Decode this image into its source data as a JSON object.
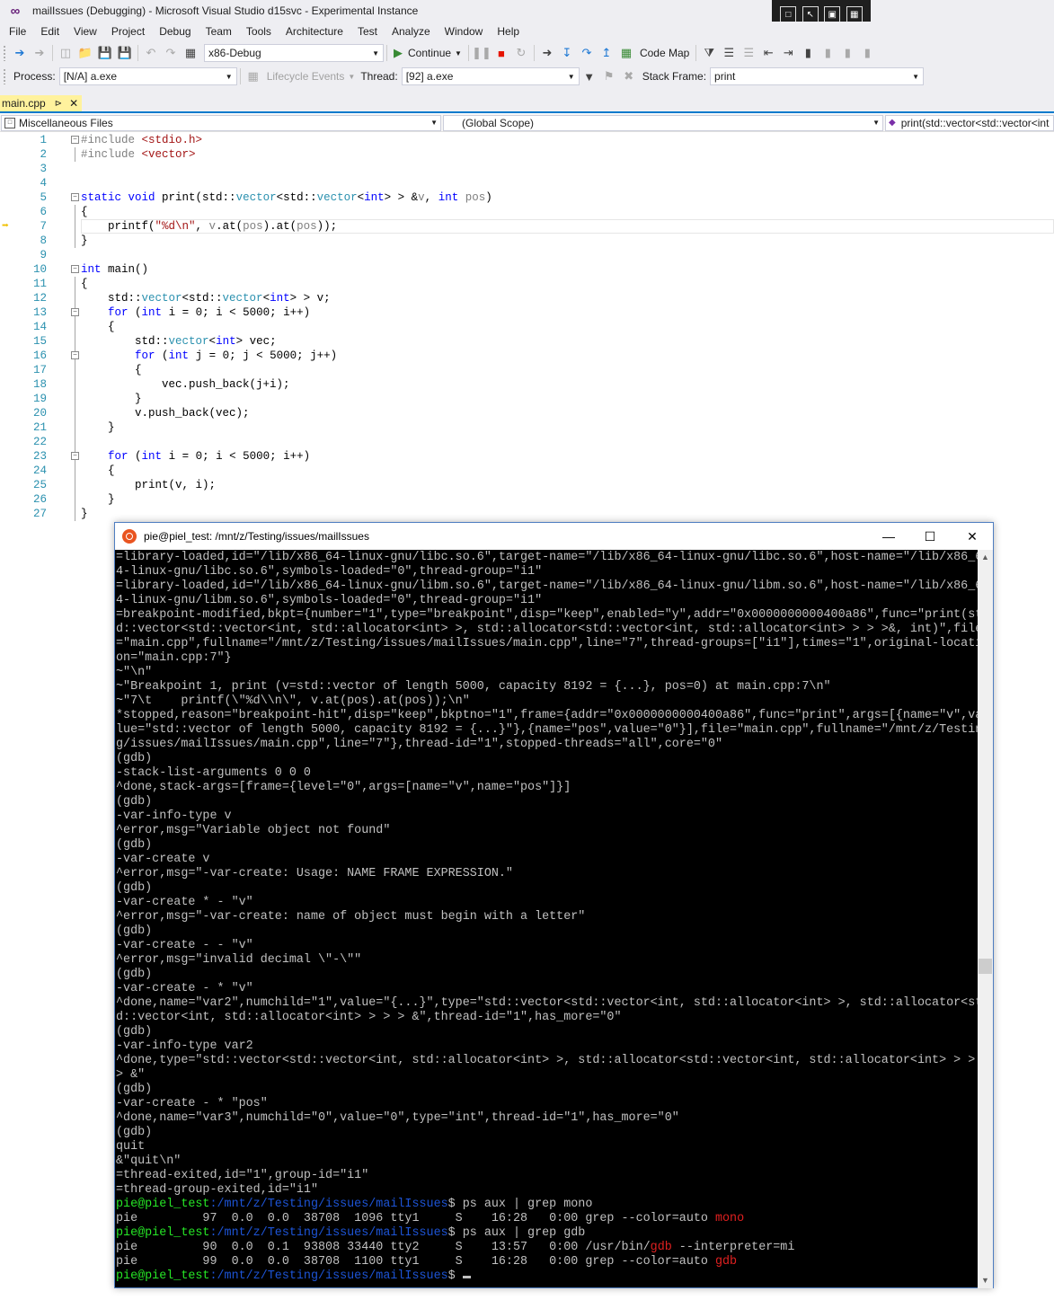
{
  "window": {
    "title": "mailIssues (Debugging) - Microsoft Visual Studio d15svc - Experimental Instance",
    "logo": "vs-logo"
  },
  "menu": [
    "File",
    "Edit",
    "View",
    "Project",
    "Debug",
    "Team",
    "Tools",
    "Architecture",
    "Test",
    "Analyze",
    "Window",
    "Help"
  ],
  "toolbar": {
    "config": "x86-Debug",
    "continue_label": "Continue",
    "code_map_label": "Code Map"
  },
  "debug_location": {
    "process_label": "Process:",
    "process_value": "[N/A] a.exe",
    "lifecycle_label": "Lifecycle Events",
    "thread_label": "Thread:",
    "thread_value": "[92] a.exe",
    "stack_frame_label": "Stack Frame:",
    "stack_frame_value": "print"
  },
  "editor_tab": {
    "filename": "main.cpp"
  },
  "navbar": {
    "project": "Miscellaneous Files",
    "scope": "(Global Scope)",
    "member": "print(std::vector<std::vector<int"
  },
  "code_lines": [
    {
      "n": "1",
      "html": "<span class=\"pp\">#include</span> <span class=\"str\">&lt;stdio.h&gt;</span>"
    },
    {
      "n": "2",
      "html": "<span class=\"pp\">#include</span> <span class=\"str\">&lt;vector&gt;</span>"
    },
    {
      "n": "3",
      "html": ""
    },
    {
      "n": "4",
      "html": ""
    },
    {
      "n": "5",
      "html": "<span class=\"kw\">static</span> <span class=\"kw\">void</span> print(std::<span class=\"typ\">vector</span>&lt;std::<span class=\"typ\">vector</span>&lt;<span class=\"kw\">int</span>&gt; &gt; &amp;<span class=\"param\">v</span>, <span class=\"kw\">int</span> <span class=\"param\">pos</span>)"
    },
    {
      "n": "6",
      "html": "{"
    },
    {
      "n": "7",
      "html": "    printf(<span class=\"str\">\"%d\\n\"</span>, <span class=\"param\">v</span>.at(<span class=\"param\">pos</span>).at(<span class=\"param\">pos</span>));"
    },
    {
      "n": "8",
      "html": "}"
    },
    {
      "n": "9",
      "html": ""
    },
    {
      "n": "10",
      "html": "<span class=\"kw\">int</span> main()"
    },
    {
      "n": "11",
      "html": "{"
    },
    {
      "n": "12",
      "html": "    std::<span class=\"typ\">vector</span>&lt;std::<span class=\"typ\">vector</span>&lt;<span class=\"kw\">int</span>&gt; &gt; v;"
    },
    {
      "n": "13",
      "html": "    <span class=\"kw\">for</span> (<span class=\"kw\">int</span> i = 0; i &lt; 5000; i++)"
    },
    {
      "n": "14",
      "html": "    {"
    },
    {
      "n": "15",
      "html": "        std::<span class=\"typ\">vector</span>&lt;<span class=\"kw\">int</span>&gt; vec;"
    },
    {
      "n": "16",
      "html": "        <span class=\"kw\">for</span> (<span class=\"kw\">int</span> j = 0; j &lt; 5000; j++)"
    },
    {
      "n": "17",
      "html": "        {"
    },
    {
      "n": "18",
      "html": "            vec.push_back(j+i);"
    },
    {
      "n": "19",
      "html": "        }"
    },
    {
      "n": "20",
      "html": "        v.push_back(vec);"
    },
    {
      "n": "21",
      "html": "    }"
    },
    {
      "n": "22",
      "html": ""
    },
    {
      "n": "23",
      "html": "    <span class=\"kw\">for</span> (<span class=\"kw\">int</span> i = 0; i &lt; 5000; i++)"
    },
    {
      "n": "24",
      "html": "    {"
    },
    {
      "n": "25",
      "html": "        print(v, i);"
    },
    {
      "n": "26",
      "html": "    }"
    },
    {
      "n": "27",
      "html": "}"
    }
  ],
  "terminal": {
    "title": "pie@piel_test: /mnt/z/Testing/issues/mailIssues",
    "lines": [
      "=library-loaded,id=\"/lib/x86_64-linux-gnu/libc.so.6\",target-name=\"/lib/x86_64-linux-gnu/libc.so.6\",host-name=\"/lib/x86_6",
      "4-linux-gnu/libc.so.6\",symbols-loaded=\"0\",thread-group=\"i1\"",
      "=library-loaded,id=\"/lib/x86_64-linux-gnu/libm.so.6\",target-name=\"/lib/x86_64-linux-gnu/libm.so.6\",host-name=\"/lib/x86_6",
      "4-linux-gnu/libm.so.6\",symbols-loaded=\"0\",thread-group=\"i1\"",
      "=breakpoint-modified,bkpt={number=\"1\",type=\"breakpoint\",disp=\"keep\",enabled=\"y\",addr=\"0x0000000000400a86\",func=\"print(st",
      "d::vector<std::vector<int, std::allocator<int> >, std::allocator<std::vector<int, std::allocator<int> > > >&, int)\",file",
      "=\"main.cpp\",fullname=\"/mnt/z/Testing/issues/mailIssues/main.cpp\",line=\"7\",thread-groups=[\"i1\"],times=\"1\",original-locati",
      "on=\"main.cpp:7\"}",
      "~\"\\n\"",
      "~\"Breakpoint 1, print (v=std::vector of length 5000, capacity 8192 = {...}, pos=0) at main.cpp:7\\n\"",
      "~\"7\\t    printf(\\\"%d\\\\n\\\", v.at(pos).at(pos));\\n\"",
      "*stopped,reason=\"breakpoint-hit\",disp=\"keep\",bkptno=\"1\",frame={addr=\"0x0000000000400a86\",func=\"print\",args=[{name=\"v\",va",
      "lue=\"std::vector of length 5000, capacity 8192 = {...}\"},{name=\"pos\",value=\"0\"}],file=\"main.cpp\",fullname=\"/mnt/z/Testin",
      "g/issues/mailIssues/main.cpp\",line=\"7\"},thread-id=\"1\",stopped-threads=\"all\",core=\"0\"",
      "(gdb)",
      "-stack-list-arguments 0 0 0",
      "^done,stack-args=[frame={level=\"0\",args=[name=\"v\",name=\"pos\"]}]",
      "(gdb)",
      "-var-info-type v",
      "^error,msg=\"Variable object not found\"",
      "(gdb)",
      "-var-create v",
      "^error,msg=\"-var-create: Usage: NAME FRAME EXPRESSION.\"",
      "(gdb)",
      "-var-create * - \"v\"",
      "^error,msg=\"-var-create: name of object must begin with a letter\"",
      "(gdb)",
      "-var-create - - \"v\"",
      "^error,msg=\"invalid decimal \\\"-\\\"\"",
      "(gdb)",
      "-var-create - * \"v\"",
      "^done,name=\"var2\",numchild=\"1\",value=\"{...}\",type=\"std::vector<std::vector<int, std::allocator<int> >, std::allocator<st",
      "d::vector<int, std::allocator<int> > > > &\",thread-id=\"1\",has_more=\"0\"",
      "(gdb)",
      "-var-info-type var2",
      "^done,type=\"std::vector<std::vector<int, std::allocator<int> >, std::allocator<std::vector<int, std::allocator<int> > >",
      "> &\"",
      "(gdb)",
      "-var-create - * \"pos\"",
      "^done,name=\"var3\",numchild=\"0\",value=\"0\",type=\"int\",thread-id=\"1\",has_more=\"0\"",
      "(gdb)",
      "quit",
      "&\"quit\\n\"",
      "=thread-exited,id=\"1\",group-id=\"i1\"",
      "=thread-group-exited,id=\"i1\""
    ],
    "prompt_user": "pie@piel_test",
    "prompt_path": ":/mnt/z/Testing/issues/mailIssues",
    "cmd1": "$ ps aux | grep mono",
    "ps1_pre": "pie         97  0.0  0.0  38708  1096 tty1     S    16:28   0:00 grep --color=auto ",
    "ps1_hl": "mono",
    "cmd2": "$ ps aux | grep gdb",
    "ps2a_pre": "pie         90  0.0  0.1  93808 33440 tty2     S    13:57   0:00 /usr/bin/",
    "ps2a_hl": "gdb",
    "ps2a_post": " --interpreter=mi",
    "ps2b_pre": "pie         99  0.0  0.0  38708  1100 tty1     S    16:28   0:00 grep --color=auto ",
    "ps2b_hl": "gdb",
    "final_prompt_end": "$ "
  }
}
